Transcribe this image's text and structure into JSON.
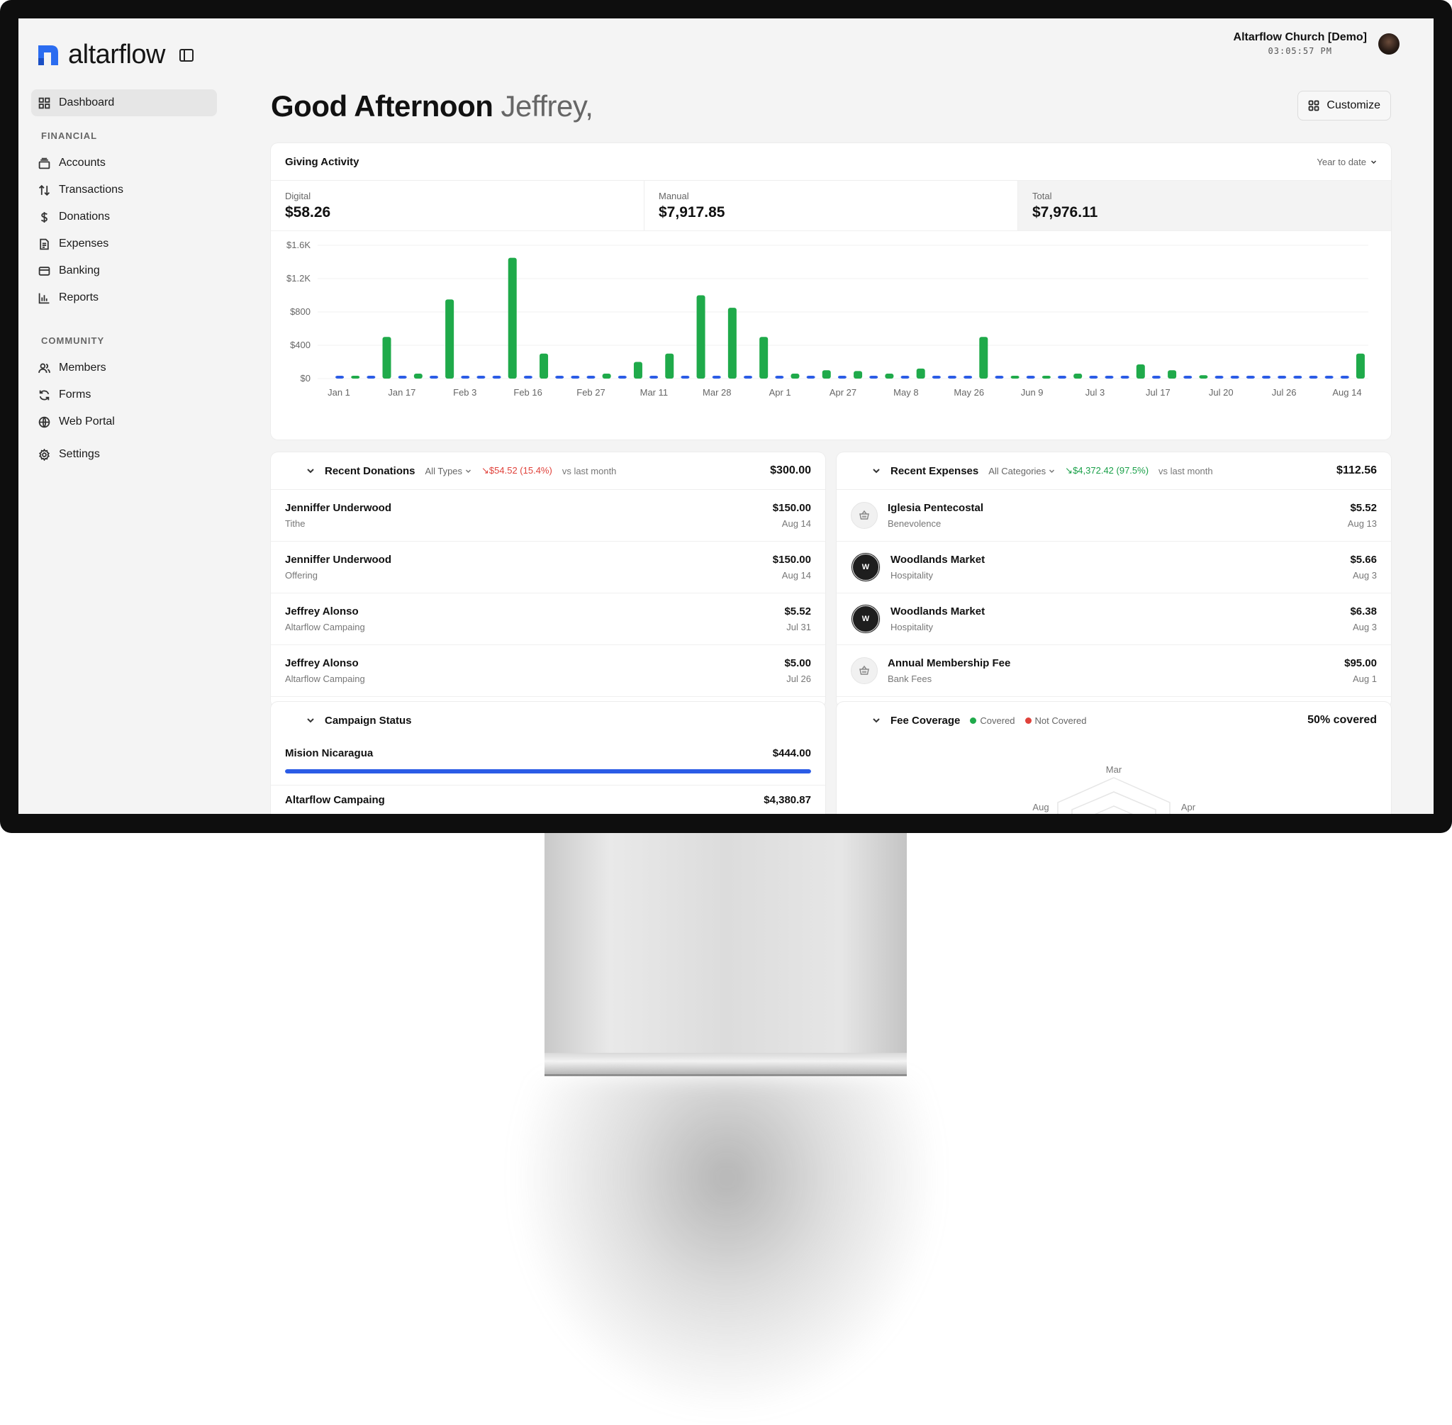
{
  "brand": {
    "name": "altarflow",
    "accent": "#2b6cf0"
  },
  "account": {
    "org": "Altarflow Church [Demo]",
    "time": "03:05:57 PM"
  },
  "sidebar": {
    "items": [
      {
        "label": "Dashboard",
        "icon": "dashboard-icon",
        "active": true
      }
    ],
    "sections": [
      {
        "title": "FINANCIAL",
        "items": [
          {
            "label": "Accounts",
            "icon": "accounts-icon"
          },
          {
            "label": "Transactions",
            "icon": "transactions-icon"
          },
          {
            "label": "Donations",
            "icon": "dollar-icon"
          },
          {
            "label": "Expenses",
            "icon": "receipt-icon"
          },
          {
            "label": "Banking",
            "icon": "card-icon"
          },
          {
            "label": "Reports",
            "icon": "bar-chart-icon"
          }
        ]
      },
      {
        "title": "COMMUNITY",
        "items": [
          {
            "label": "Members",
            "icon": "users-icon"
          },
          {
            "label": "Forms",
            "icon": "refresh-icon"
          },
          {
            "label": "Web Portal",
            "icon": "globe-icon"
          }
        ]
      }
    ],
    "settings": {
      "label": "Settings",
      "icon": "gear-icon"
    }
  },
  "header": {
    "greeting": "Good Afternoon",
    "name": "Jeffrey,",
    "customize_label": "Customize"
  },
  "giving": {
    "title": "Giving Activity",
    "period": "Year to date",
    "stats": [
      {
        "label": "Digital",
        "value": "$58.26"
      },
      {
        "label": "Manual",
        "value": "$7,917.85"
      },
      {
        "label": "Total",
        "value": "$7,976.11"
      }
    ]
  },
  "chart_data": {
    "type": "bar",
    "y_ticks": [
      "$0",
      "$400",
      "$800",
      "$1.2K",
      "$1.6K"
    ],
    "y_tick_values": [
      0,
      400,
      800,
      1200,
      1600
    ],
    "ylim": [
      0,
      1600
    ],
    "x_tick_labels": [
      "Jan 1",
      "Jan 17",
      "Feb 3",
      "Feb 16",
      "Feb 27",
      "Mar 11",
      "Mar 28",
      "Apr 1",
      "Apr 27",
      "May 8",
      "May 26",
      "Jun 9",
      "Jul 3",
      "Jul 17",
      "Jul 20",
      "Jul 26",
      "Aug 14"
    ],
    "colors": {
      "manual": "#1faa4a",
      "digital": "#2b5ce6"
    },
    "series": [
      {
        "values": [
          0,
          10,
          0,
          500,
          0,
          60,
          0,
          950,
          0,
          0,
          0,
          1450,
          0,
          300,
          0,
          0,
          0,
          60,
          0,
          200,
          0,
          300,
          0,
          1000,
          0,
          850,
          0,
          500,
          0,
          60,
          0,
          100,
          0,
          90,
          0,
          60,
          0,
          120,
          0,
          0,
          0,
          500,
          0,
          20,
          0,
          20,
          0,
          60,
          0,
          0,
          0,
          170,
          0,
          100,
          0,
          40,
          0,
          0,
          0,
          0,
          0,
          0,
          0,
          0,
          0,
          300
        ]
      },
      {
        "values": [
          10,
          0,
          10,
          0,
          10,
          0,
          10,
          0,
          10,
          10,
          10,
          0,
          10,
          0,
          10,
          10,
          10,
          0,
          10,
          0,
          10,
          0,
          10,
          0,
          10,
          0,
          10,
          0,
          10,
          0,
          10,
          0,
          10,
          0,
          10,
          0,
          10,
          0,
          10,
          10,
          10,
          0,
          10,
          0,
          10,
          0,
          10,
          0,
          10,
          10,
          10,
          0,
          10,
          0,
          10,
          0,
          10,
          10,
          10,
          10,
          10,
          10,
          10,
          10,
          10,
          0
        ]
      }
    ]
  },
  "donations": {
    "title": "Recent Donations",
    "filter": "All Types",
    "trend": "↘$54.52 (15.4%)",
    "trend_suffix": "vs last month",
    "total": "$300.00",
    "rows": [
      {
        "name": "Jenniffer Underwood",
        "sub": "Tithe",
        "amount": "$150.00",
        "date": "Aug 14"
      },
      {
        "name": "Jenniffer Underwood",
        "sub": "Offering",
        "amount": "$150.00",
        "date": "Aug 14"
      },
      {
        "name": "Jeffrey Alonso",
        "sub": "Altarflow Campaing",
        "amount": "$5.52",
        "date": "Jul 31"
      },
      {
        "name": "Jeffrey Alonso",
        "sub": "Altarflow Campaing",
        "amount": "$5.00",
        "date": "Jul 26"
      }
    ]
  },
  "expenses": {
    "title": "Recent Expenses",
    "filter": "All Categories",
    "trend": "↘$4,372.42 (97.5%)",
    "trend_suffix": "vs last month",
    "total": "$112.56",
    "rows": [
      {
        "name": "Iglesia Pentecostal",
        "sub": "Benevolence",
        "amount": "$5.52",
        "date": "Aug 13",
        "icon": "basket-icon"
      },
      {
        "name": "Woodlands Market",
        "sub": "Hospitality",
        "amount": "$5.66",
        "date": "Aug 3",
        "icon": "woodlands-logo-icon"
      },
      {
        "name": "Woodlands Market",
        "sub": "Hospitality",
        "amount": "$6.38",
        "date": "Aug 3",
        "icon": "woodlands-logo-icon"
      },
      {
        "name": "Annual Membership Fee",
        "sub": "Bank Fees",
        "amount": "$95.00",
        "date": "Aug 1",
        "icon": "basket-icon"
      }
    ]
  },
  "campaign": {
    "title": "Campaign Status",
    "items": [
      {
        "name": "Mision Nicaragua",
        "amount": "$444.00",
        "progress": 1.0
      },
      {
        "name": "Altarflow Campaing",
        "amount": "$4,380.87"
      }
    ]
  },
  "fee": {
    "title": "Fee Coverage",
    "legend_covered": "Covered",
    "legend_not_covered": "Not Covered",
    "summary": "50% covered",
    "radar_labels": [
      "Mar",
      "Apr",
      "Aug"
    ],
    "colors": {
      "covered": "#1faa4a",
      "not_covered": "#e0423b"
    }
  }
}
